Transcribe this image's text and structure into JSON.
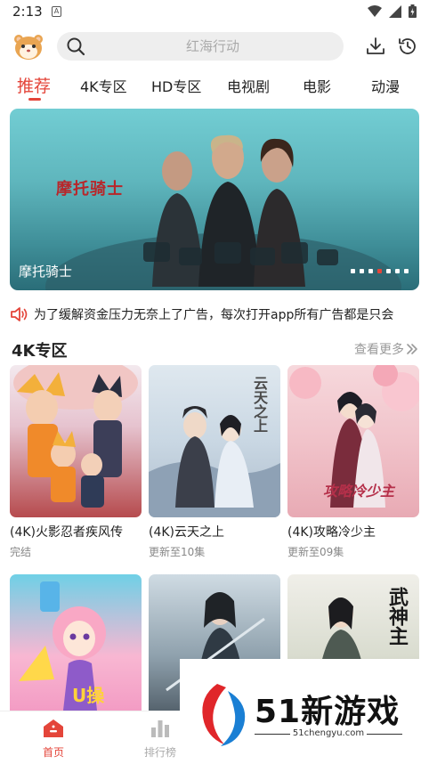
{
  "status_bar": {
    "time": "2:13",
    "indicator": "A"
  },
  "search": {
    "placeholder": "红海行动"
  },
  "tabs": [
    {
      "label": "推荐",
      "active": true
    },
    {
      "label": "4K专区"
    },
    {
      "label": "HD专区"
    },
    {
      "label": "电视剧"
    },
    {
      "label": "电影"
    },
    {
      "label": "动漫"
    }
  ],
  "banner": {
    "title_art": "摩托骑士",
    "caption": "摩托骑士",
    "dot_count": 7,
    "active_dot": 3
  },
  "notice": {
    "text": "为了缓解资金压力无奈上了广告，每次打开app所有广告都是只会"
  },
  "section": {
    "title": "4K专区",
    "more_label": "查看更多"
  },
  "cards": [
    {
      "title": "(4K)火影忍者疾风传",
      "subtitle": "完结"
    },
    {
      "title": "(4K)云天之上",
      "subtitle": "更新至10集",
      "poster_text": "云天之上"
    },
    {
      "title": "(4K)攻略冷少主",
      "subtitle": "更新至09集",
      "poster_text": "攻略冷少主"
    }
  ],
  "cards_row2": [
    {
      "poster_text": "U操"
    },
    {
      "poster_text": ""
    },
    {
      "poster_text": "武神主"
    }
  ],
  "bottom_nav": [
    {
      "label": "首页",
      "active": true
    },
    {
      "label": "排行榜"
    }
  ],
  "watermark": {
    "text": "51新游戏",
    "url": "51chengyu.com"
  },
  "colors": {
    "accent": "#e4453a",
    "muted": "#999999"
  }
}
